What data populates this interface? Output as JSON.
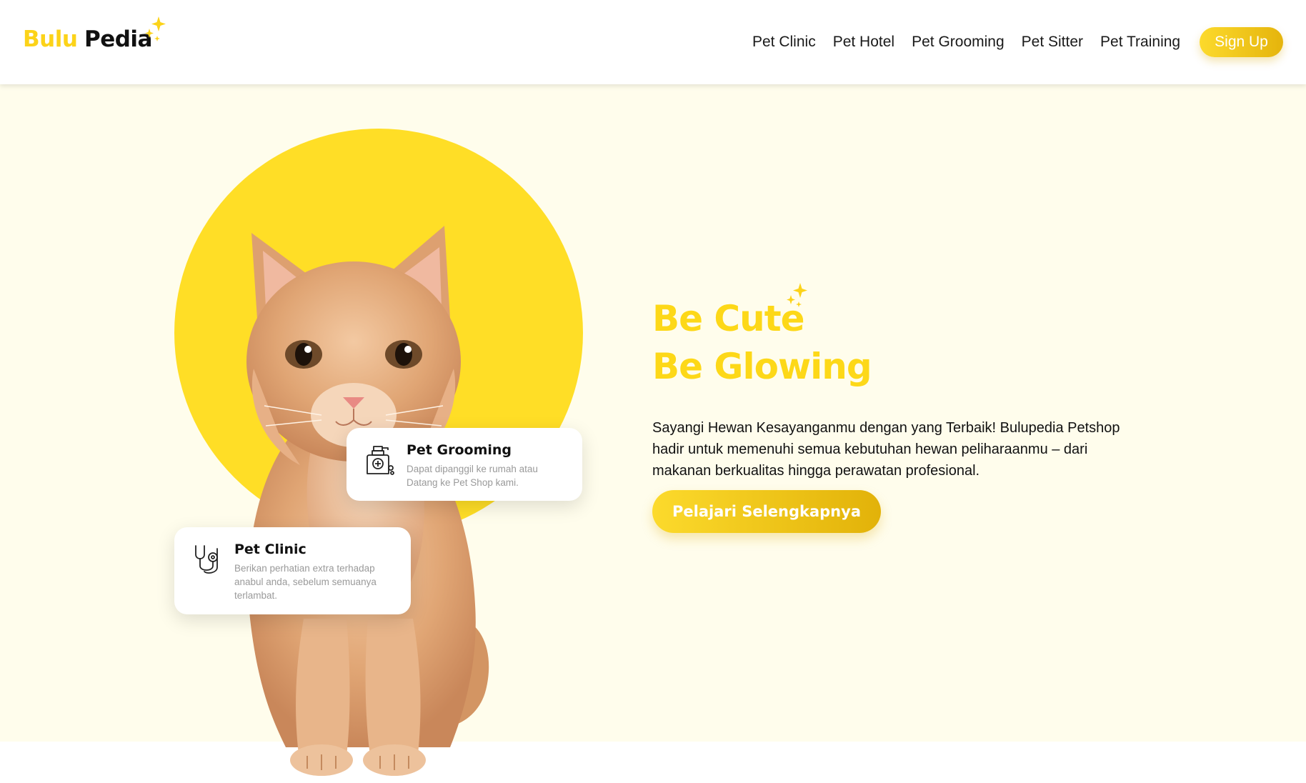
{
  "brand": {
    "name_part1": "Bulu",
    "name_part2": "Pedia",
    "color": "#FCD319"
  },
  "nav": {
    "links": [
      "Pet Clinic",
      "Pet Hotel",
      "Pet Grooming",
      "Pet Sitter",
      "Pet Training"
    ],
    "signup_label": "Sign Up"
  },
  "hero": {
    "headline_line1": "Be Cute",
    "headline_line2": "Be Glowing",
    "description": "Sayangi Hewan Kesayanganmu dengan yang Terbaik! Bulupedia Petshop hadir untuk memenuhi semua kebutuhan hewan peliharaanmu – dari makanan berkualitas hingga perawatan profesional.",
    "cta_label": "Pelajari Selengkapnya",
    "accent_color": "#FDD818",
    "background_color": "#FFFDEC",
    "circle_color": "#FFDE26"
  },
  "cards": {
    "grooming": {
      "title": "Pet Grooming",
      "description": "Dapat dipanggil ke rumah atau Datang ke Pet Shop kami.",
      "icon": "shampoo-bottle-icon"
    },
    "clinic": {
      "title": "Pet Clinic",
      "description": "Berikan perhatian extra terhadap anabul anda, sebelum semuanya terlambat.",
      "icon": "stethoscope-icon"
    }
  }
}
